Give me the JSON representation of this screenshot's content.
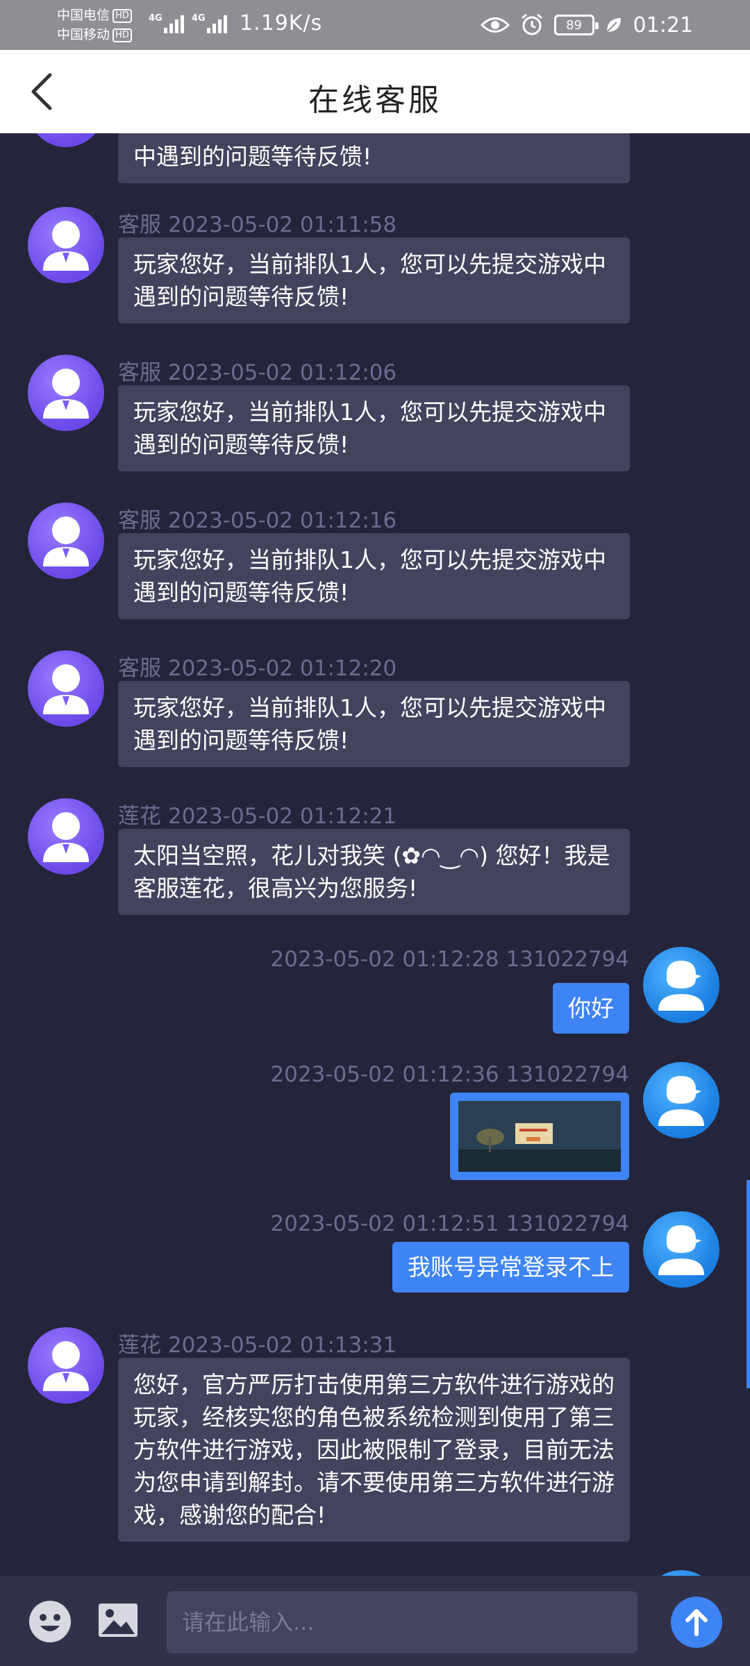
{
  "status_bar": {
    "carrier1": "中国电信",
    "carrier2": "中国移动",
    "hd": "HD",
    "network": "4G",
    "net_speed": "1.19K/s",
    "battery": "89",
    "time": "01:21"
  },
  "header": {
    "title": "在线客服"
  },
  "messages": [
    {
      "sender": "",
      "time": "",
      "text": "中遇到的问题等待反馈!"
    },
    {
      "sender": "客服",
      "time": "2023-05-02 01:11:58",
      "text": "玩家您好，当前排队1人，您可以先提交游戏中遇到的问题等待反馈!"
    },
    {
      "sender": "客服",
      "time": "2023-05-02 01:12:06",
      "text": "玩家您好，当前排队1人，您可以先提交游戏中遇到的问题等待反馈!"
    },
    {
      "sender": "客服",
      "time": "2023-05-02 01:12:16",
      "text": "玩家您好，当前排队1人，您可以先提交游戏中遇到的问题等待反馈!"
    },
    {
      "sender": "客服",
      "time": "2023-05-02 01:12:20",
      "text": "玩家您好，当前排队1人，您可以先提交游戏中遇到的问题等待反馈!"
    },
    {
      "sender": "莲花",
      "time": "2023-05-02 01:12:21",
      "text": "太阳当空照，花儿对我笑 (✿◠‿◠) 您好！我是客服莲花，很高兴为您服务!"
    },
    {
      "meta": "2023-05-02 01:12:28 131022794",
      "text": "你好"
    },
    {
      "meta": "2023-05-02 01:12:36 131022794"
    },
    {
      "meta": "2023-05-02 01:12:51 131022794",
      "text": "我账号异常登录不上"
    },
    {
      "sender": "莲花",
      "time": "2023-05-02 01:13:31",
      "text": "您好，官方严厉打击使用第三方软件进行游戏的玩家，经核实您的角色被系统检测到使用了第三方软件进行游戏，因此被限制了登录，目前无法为您申请到解封。请不要使用第三方软件进行游戏，感谢您的配合!"
    }
  ],
  "input": {
    "placeholder": "请在此输入..."
  },
  "colors": {
    "background": "#24243a",
    "agent_bubble": "#43435e",
    "user_bubble": "#3f84f5",
    "header_bg": "#ffffff"
  }
}
